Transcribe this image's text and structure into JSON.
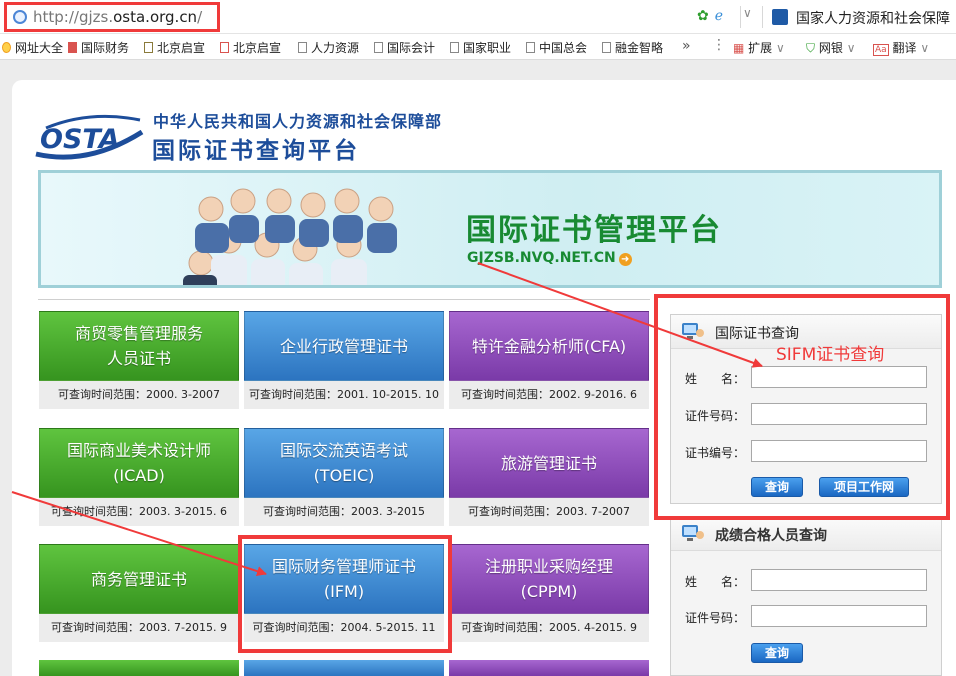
{
  "browser": {
    "url_prefix": "http://gjzs.",
    "url_domain": "osta.org.cn",
    "url_suffix": "/",
    "tab_title": "国家人力资源和社会保障",
    "bookmarks": [
      "网址大全",
      "国际财务",
      "北京启宣",
      "北京启宣",
      "人力资源",
      "国际会计",
      "国家职业",
      "中国总会",
      "融金智略"
    ],
    "more": "»",
    "tools": [
      {
        "label": "扩展",
        "icon": "grid-icon",
        "color": "#d9534f"
      },
      {
        "label": "网银",
        "icon": "shield-icon",
        "color": "#2e9e2e"
      },
      {
        "label": "翻译",
        "icon": "translate-icon",
        "color": "#d9534f"
      }
    ]
  },
  "header": {
    "logo_text": "OSTA",
    "ministry": "中华人民共和国人力资源和社会保障部",
    "platform": "国际证书查询平台"
  },
  "banner": {
    "title": "国际证书管理平台",
    "url": "GJZSB.NVQ.NET.CN"
  },
  "certs": [
    {
      "lines": [
        "商贸零售管理服务",
        "人员证书"
      ],
      "range_label": "可查询时间范围：",
      "range": "2000. 3-2007",
      "color": "green"
    },
    {
      "lines": [
        "企业行政管理证书"
      ],
      "range_label": "可查询时间范围：",
      "range": "2001. 10-2015. 10",
      "color": "blue"
    },
    {
      "lines": [
        "特许金融分析师(CFA)"
      ],
      "range_label": "可查询时间范围：",
      "range": "2002. 9-2016. 6",
      "color": "purple"
    },
    {
      "lines": [
        "国际商业美术设计师",
        "(ICAD)"
      ],
      "range_label": "可查询时间范围：",
      "range": "2003. 3-2015. 6",
      "color": "green"
    },
    {
      "lines": [
        "国际交流英语考试",
        "(TOEIC)"
      ],
      "range_label": "可查询时间范围：",
      "range": "2003. 3-2015",
      "color": "blue"
    },
    {
      "lines": [
        "旅游管理证书"
      ],
      "range_label": "可查询时间范围：",
      "range": "2003. 7-2007",
      "color": "purple"
    },
    {
      "lines": [
        "商务管理证书"
      ],
      "range_label": "可查询时间范围：",
      "range": "2003. 7-2015. 9",
      "color": "green"
    },
    {
      "lines": [
        "国际财务管理师证书",
        "(IFM)"
      ],
      "range_label": "可查询时间范围：",
      "range": "2004. 5-2015. 11",
      "color": "blue"
    },
    {
      "lines": [
        "注册职业采购经理",
        "(CPPM)"
      ],
      "range_label": "可查询时间范围：",
      "range": "2005. 4-2015. 9",
      "color": "purple"
    }
  ],
  "cert_query": {
    "title": "国际证书查询",
    "name_label": "姓　　名：",
    "id_label": "证件号码：",
    "cert_no_label": "证书编号：",
    "name_value": "",
    "id_value": "",
    "cert_no_value": "",
    "search_button": "查询",
    "project_button": "项目工作网"
  },
  "score_query": {
    "title": "成绩合格人员查询",
    "name_label": "姓　　名：",
    "id_label": "证件号码：",
    "name_value": "",
    "id_value": "",
    "search_button": "查询"
  },
  "annotation": {
    "note": "SIFM证书查询",
    "color": "#f03a3a"
  }
}
